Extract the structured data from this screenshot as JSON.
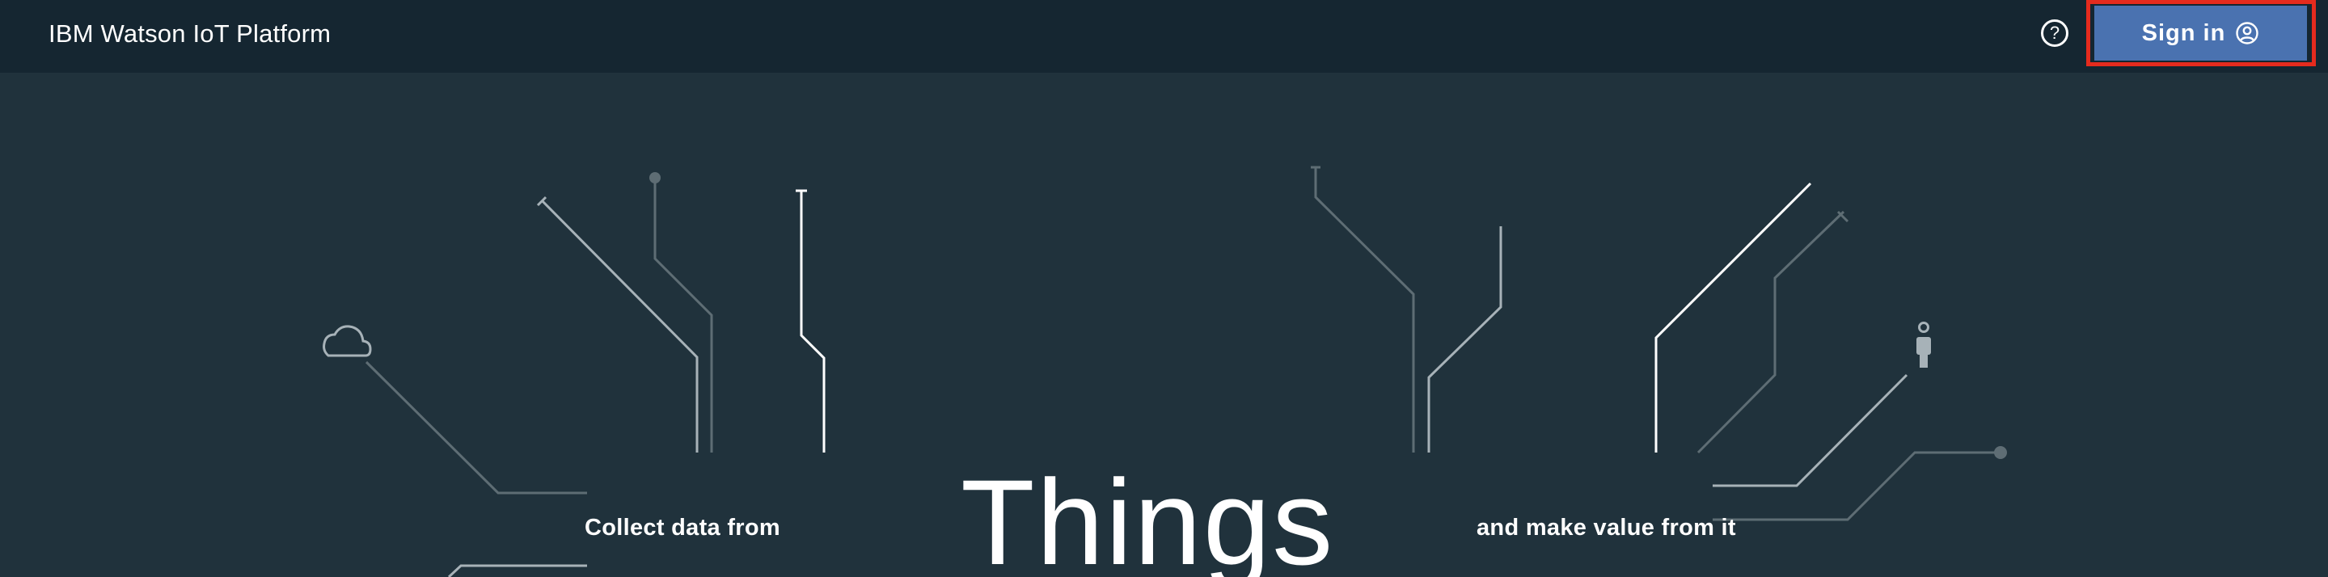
{
  "header": {
    "brand": "IBM Watson IoT Platform",
    "help_glyph": "?",
    "help_icon": "help-circle-icon",
    "signin_label": "Sign in",
    "signin_icon": "user-circle-icon"
  },
  "hero": {
    "left_caption": "Collect data from",
    "headline": "Things",
    "right_caption": "and make value from it"
  },
  "decor_icons": [
    "cloud-icon",
    "person-icon"
  ],
  "colors": {
    "background": "#20323c",
    "topbar": "#152631",
    "signin_button": "#4a72b0",
    "signin_highlight": "#e52b1e",
    "line_light": "#ffffff",
    "line_mid": "#a7b2b8",
    "line_dim": "#5e6d74"
  }
}
